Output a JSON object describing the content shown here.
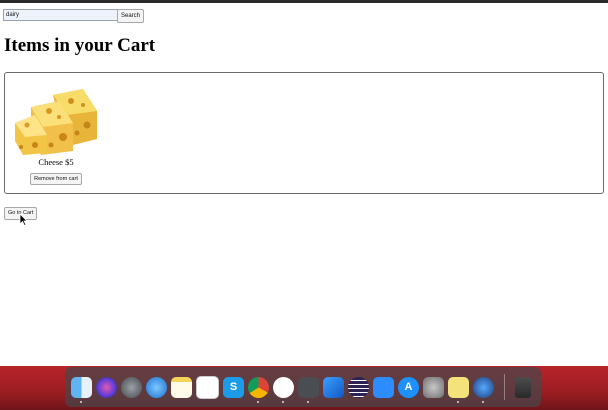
{
  "search": {
    "value": "dairy",
    "button_label": "Search"
  },
  "page_title": "Items in your Cart",
  "cart": {
    "items": [
      {
        "caption": "Cheese $5",
        "remove_label": "Remove from cart"
      }
    ]
  },
  "go_to_cart_label": "Go to Cart",
  "colors": {
    "desktop": "#b8242a",
    "dock": "#4a4a4f"
  },
  "dock_apps": [
    "finder-icon",
    "siri-icon",
    "launchpad-icon",
    "safari-icon",
    "notes-icon",
    "reminders-icon",
    "skype-icon",
    "chrome-icon",
    "slack-icon",
    "sublime-icon",
    "xcode-icon",
    "eclipse-icon",
    "zoom-icon",
    "app-store-icon",
    "system-preferences-icon",
    "stickies-icon",
    "photoshop-icon",
    "trash-icon"
  ]
}
